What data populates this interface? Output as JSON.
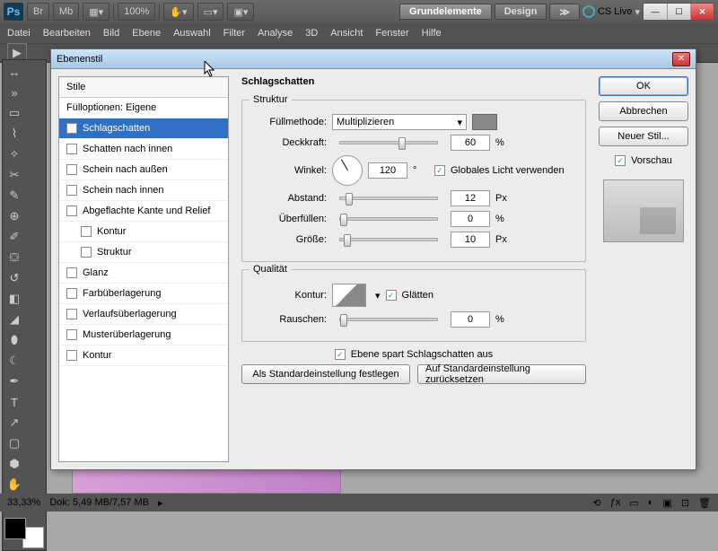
{
  "appbar": {
    "zoom": "100%",
    "workspaces": [
      "Grundelemente",
      "Design"
    ],
    "cslive": "CS Live"
  },
  "menu": [
    "Datei",
    "Bearbeiten",
    "Bild",
    "Ebene",
    "Auswahl",
    "Filter",
    "Analyse",
    "3D",
    "Ansicht",
    "Fenster",
    "Hilfe"
  ],
  "dialog": {
    "title": "Ebenenstil",
    "styles_header": "Stile",
    "blend_options": "Fülloptionen: Eigene",
    "items": [
      {
        "label": "Schlagschatten",
        "checked": true,
        "selected": true
      },
      {
        "label": "Schatten nach innen",
        "checked": false
      },
      {
        "label": "Schein nach außen",
        "checked": false
      },
      {
        "label": "Schein nach innen",
        "checked": false
      },
      {
        "label": "Abgeflachte Kante und Relief",
        "checked": false
      },
      {
        "label": "Kontur",
        "checked": false,
        "indent": true
      },
      {
        "label": "Struktur",
        "checked": false,
        "indent": true
      },
      {
        "label": "Glanz",
        "checked": false
      },
      {
        "label": "Farbüberlagerung",
        "checked": false
      },
      {
        "label": "Verlaufsüberlagerung",
        "checked": false
      },
      {
        "label": "Musterüberlagerung",
        "checked": false
      },
      {
        "label": "Kontur",
        "checked": false
      }
    ],
    "panel_title": "Schlagschatten",
    "structure_title": "Struktur",
    "quality_title": "Qualität",
    "labels": {
      "blendmode": "Füllmethode:",
      "opacity": "Deckkraft:",
      "angle": "Winkel:",
      "global": "Globales Licht verwenden",
      "distance": "Abstand:",
      "spread": "Überfüllen:",
      "size": "Größe:",
      "contour": "Kontur:",
      "antialias": "Glätten",
      "noise": "Rauschen:",
      "knockout": "Ebene spart Schlagschatten aus",
      "setdefault": "Als Standardeinstellung festlegen",
      "resetdefault": "Auf Standardeinstellung zurücksetzen"
    },
    "values": {
      "blendmode": "Multiplizieren",
      "opacity": "60",
      "angle": "120",
      "distance": "12",
      "spread": "0",
      "size": "10",
      "noise": "0"
    },
    "units": {
      "pct": "%",
      "deg": "°",
      "px": "Px"
    },
    "buttons": {
      "ok": "OK",
      "cancel": "Abbrechen",
      "newstyle": "Neuer Stil...",
      "preview": "Vorschau"
    }
  },
  "status": {
    "zoom": "33,33%",
    "doc": "Dok: 5,49 MB/7,57 MB"
  }
}
